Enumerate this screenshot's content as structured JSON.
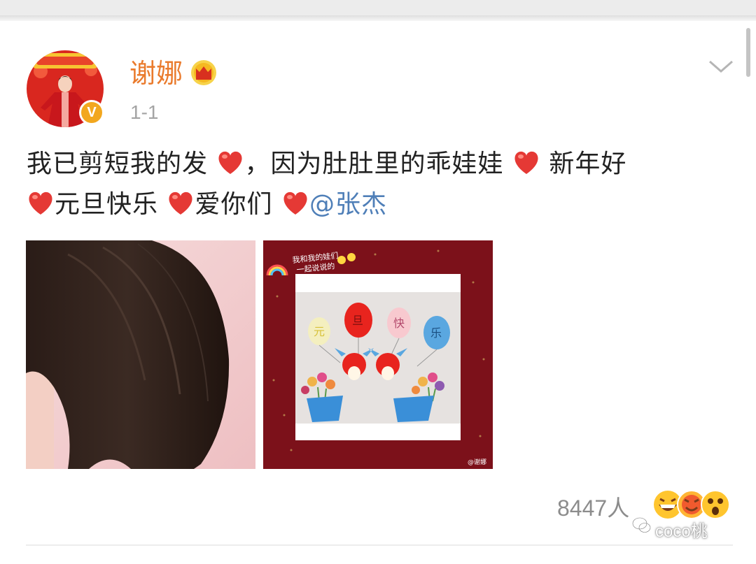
{
  "post": {
    "username": "谢娜",
    "time": "1-1",
    "text_segments": [
      "我已剪短我的发",
      "，因为肚肚里的乖娃娃",
      "新年好",
      "元旦快乐",
      "爱你们"
    ],
    "mention": "@张杰",
    "image2_caption_line1": "我和我的娃们",
    "image2_caption_line2": "一起说说的",
    "balloons": [
      "元",
      "旦",
      "快",
      "乐"
    ],
    "image2_watermark": "@谢娜",
    "likes_count": "8447人"
  },
  "overlay": {
    "watermark": "coco桃"
  },
  "colors": {
    "username": "#ea7b2d",
    "mention": "#4f7fb8",
    "verified_badge": "#f2a71e",
    "heart": "#e53935"
  },
  "icons": [
    "crown-icon",
    "verified-badge-icon",
    "chevron-down-icon",
    "heart-icon",
    "reaction-emoji-icon"
  ]
}
